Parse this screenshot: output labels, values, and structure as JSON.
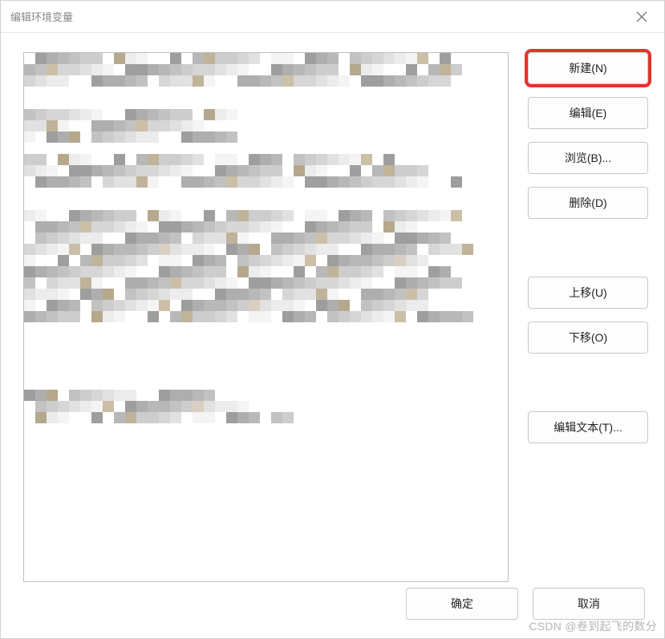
{
  "dialog": {
    "title": "编辑环境变量"
  },
  "buttons": {
    "new": "新建(N)",
    "edit": "编辑(E)",
    "browse": "浏览(B)...",
    "delete": "删除(D)",
    "moveUp": "上移(U)",
    "moveDown": "下移(O)",
    "editText": "编辑文本(T)...",
    "ok": "确定",
    "cancel": "取消"
  },
  "highlighted_button": "new",
  "watermark": "CSDN @卷到起飞的数分",
  "listbox": {
    "note": "content is blurred/pixelated and not legible",
    "visible_rows": 0
  }
}
